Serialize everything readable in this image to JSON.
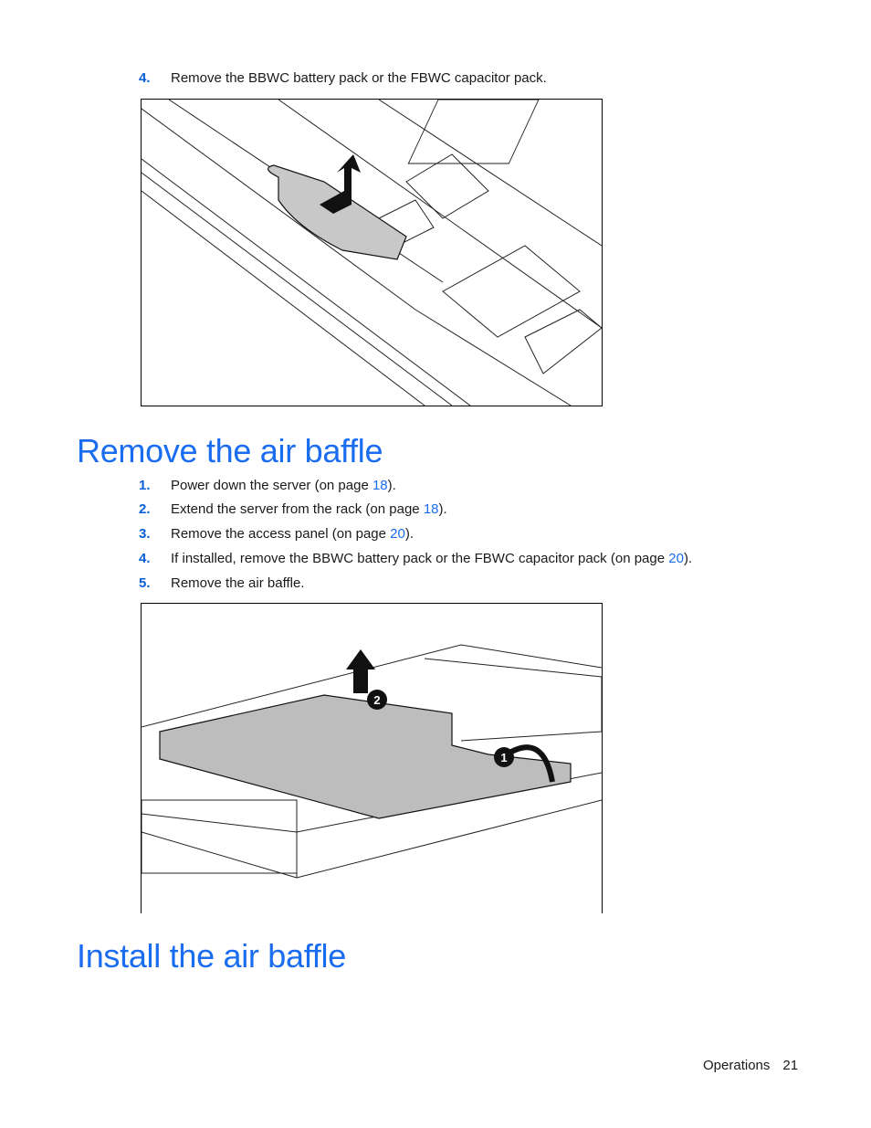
{
  "top_step": {
    "number": "4.",
    "text": "Remove the BBWC battery pack or the FBWC capacitor pack."
  },
  "figure1": {
    "alt": "Illustration: lifting the BBWC battery pack out of the server chassis"
  },
  "section1": {
    "title": "Remove the air baffle",
    "steps": [
      {
        "number": "1.",
        "text": "Power down the server (on page ",
        "link": "18",
        "suffix": ")."
      },
      {
        "number": "2.",
        "text": "Extend the server from the rack (on page ",
        "link": "18",
        "suffix": ")."
      },
      {
        "number": "3.",
        "text": "Remove the access panel (on page ",
        "link": "20",
        "suffix": ")."
      },
      {
        "number": "4.",
        "text": "If installed, remove the BBWC battery pack or the FBWC capacitor pack (on page ",
        "link": "20",
        "suffix": ")."
      },
      {
        "number": "5.",
        "text": "Remove the air baffle.",
        "link": null,
        "suffix": ""
      }
    ]
  },
  "figure2": {
    "alt": "Illustration: removing the air baffle from the server",
    "callouts": [
      "1",
      "2"
    ]
  },
  "section2": {
    "title": "Install the air baffle"
  },
  "footer": {
    "section": "Operations",
    "page": "21"
  },
  "colors": {
    "heading": "#1a6cf0",
    "step_number": "#0a5fd6",
    "link": "#1a6cf0"
  }
}
